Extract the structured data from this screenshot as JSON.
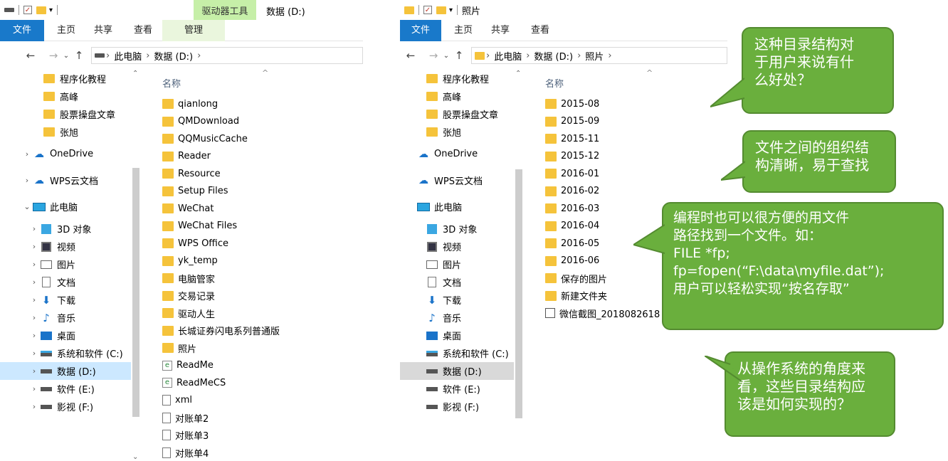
{
  "left_window": {
    "context_tab": "驱动器工具",
    "title": "数据 (D:)",
    "ribbon_tabs": [
      "文件",
      "主页",
      "共享",
      "查看",
      "管理"
    ],
    "address": [
      "此电脑",
      "数据 (D:)"
    ],
    "nav_items": [
      {
        "label": "程序化教程",
        "icon": "folder-icon"
      },
      {
        "label": "高峰",
        "icon": "folder-icon"
      },
      {
        "label": "股票操盘文章",
        "icon": "folder-icon"
      },
      {
        "label": "张旭",
        "icon": "folder-icon"
      },
      {
        "label": "OneDrive",
        "icon": "cloud-icon"
      },
      {
        "label": "WPS云文档",
        "icon": "wps-cloud-icon"
      },
      {
        "label": "此电脑",
        "icon": "computer-icon"
      },
      {
        "label": "3D 对象",
        "icon": "3d-objects-icon"
      },
      {
        "label": "视频",
        "icon": "video-icon"
      },
      {
        "label": "图片",
        "icon": "pictures-icon"
      },
      {
        "label": "文档",
        "icon": "documents-icon"
      },
      {
        "label": "下载",
        "icon": "download-icon"
      },
      {
        "label": "音乐",
        "icon": "music-icon"
      },
      {
        "label": "桌面",
        "icon": "desktop-icon"
      },
      {
        "label": "系统和软件 (C:)",
        "icon": "system-drive-icon"
      },
      {
        "label": "数据 (D:)",
        "icon": "drive-icon"
      },
      {
        "label": "软件 (E:)",
        "icon": "drive-icon"
      },
      {
        "label": "影视 (F:)",
        "icon": "drive-icon"
      }
    ],
    "column_header": "名称",
    "files": [
      {
        "name": "qianlong",
        "type": "folder"
      },
      {
        "name": "QMDownload",
        "type": "folder"
      },
      {
        "name": "QQMusicCache",
        "type": "folder"
      },
      {
        "name": "Reader",
        "type": "folder"
      },
      {
        "name": "Resource",
        "type": "folder"
      },
      {
        "name": "Setup Files",
        "type": "folder"
      },
      {
        "name": "WeChat",
        "type": "folder"
      },
      {
        "name": "WeChat Files",
        "type": "folder"
      },
      {
        "name": "WPS Office",
        "type": "folder"
      },
      {
        "name": "yk_temp",
        "type": "folder"
      },
      {
        "name": "电脑管家",
        "type": "folder"
      },
      {
        "name": "交易记录",
        "type": "folder"
      },
      {
        "name": "驱动人生",
        "type": "folder"
      },
      {
        "name": "长城证券闪电系列普通版",
        "type": "folder"
      },
      {
        "name": "照片",
        "type": "folder"
      },
      {
        "name": "ReadMe",
        "type": "html"
      },
      {
        "name": "ReadMeCS",
        "type": "html"
      },
      {
        "name": "xml",
        "type": "doc"
      },
      {
        "name": "对账单2",
        "type": "doc"
      },
      {
        "name": "对账单3",
        "type": "doc"
      },
      {
        "name": "对账单4",
        "type": "doc"
      }
    ]
  },
  "right_window": {
    "title": "照片",
    "ribbon_tabs": [
      "文件",
      "主页",
      "共享",
      "查看"
    ],
    "address": [
      "此电脑",
      "数据 (D:)",
      "照片"
    ],
    "nav_items": [
      {
        "label": "程序化教程",
        "icon": "folder-icon"
      },
      {
        "label": "高峰",
        "icon": "folder-icon"
      },
      {
        "label": "股票操盘文章",
        "icon": "folder-icon"
      },
      {
        "label": "张旭",
        "icon": "folder-icon"
      },
      {
        "label": "OneDrive",
        "icon": "cloud-icon"
      },
      {
        "label": "WPS云文档",
        "icon": "wps-cloud-icon"
      },
      {
        "label": "此电脑",
        "icon": "computer-icon"
      },
      {
        "label": "3D 对象",
        "icon": "3d-objects-icon"
      },
      {
        "label": "视频",
        "icon": "video-icon"
      },
      {
        "label": "图片",
        "icon": "pictures-icon"
      },
      {
        "label": "文档",
        "icon": "documents-icon"
      },
      {
        "label": "下载",
        "icon": "download-icon"
      },
      {
        "label": "音乐",
        "icon": "music-icon"
      },
      {
        "label": "桌面",
        "icon": "desktop-icon"
      },
      {
        "label": "系统和软件 (C:)",
        "icon": "system-drive-icon"
      },
      {
        "label": "数据 (D:)",
        "icon": "drive-icon"
      },
      {
        "label": "软件 (E:)",
        "icon": "drive-icon"
      },
      {
        "label": "影视 (F:)",
        "icon": "drive-icon"
      }
    ],
    "column_header": "名称",
    "files": [
      {
        "name": "2015-08",
        "type": "folder"
      },
      {
        "name": "2015-09",
        "type": "folder"
      },
      {
        "name": "2015-11",
        "type": "folder"
      },
      {
        "name": "2015-12",
        "type": "folder"
      },
      {
        "name": "2016-01",
        "type": "folder"
      },
      {
        "name": "2016-02",
        "type": "folder"
      },
      {
        "name": "2016-03",
        "type": "folder"
      },
      {
        "name": "2016-04",
        "type": "folder"
      },
      {
        "name": "2016-05",
        "type": "folder"
      },
      {
        "name": "2016-06",
        "type": "folder"
      },
      {
        "name": "保存的图片",
        "type": "folder"
      },
      {
        "name": "新建文件夹",
        "type": "folder"
      },
      {
        "name": "微信截图_2018082618",
        "type": "image"
      }
    ]
  },
  "callouts": [
    {
      "lines": [
        "这种目录结构对",
        "于用户来说有什",
        "么好处？"
      ]
    },
    {
      "lines": [
        "文件之间的组织结",
        "构清晰，易于查找"
      ]
    },
    {
      "lines": [
        "编程时也可以很方便的用文件",
        "路径找到一个文件。如：",
        "FILE *fp;",
        "fp=fopen(“F:\\data\\myfile.dat”);",
        "用户可以轻松实现“按名存取”"
      ]
    },
    {
      "lines": [
        "从操作系统的角度来",
        "看，这些目录结构应",
        "该是如何实现的？"
      ]
    }
  ],
  "colors": {
    "callout_fill": "#6aaf3d",
    "file_tab": "#1979ca",
    "context_tab": "#c6efa8",
    "folder": "#f5c33b"
  }
}
